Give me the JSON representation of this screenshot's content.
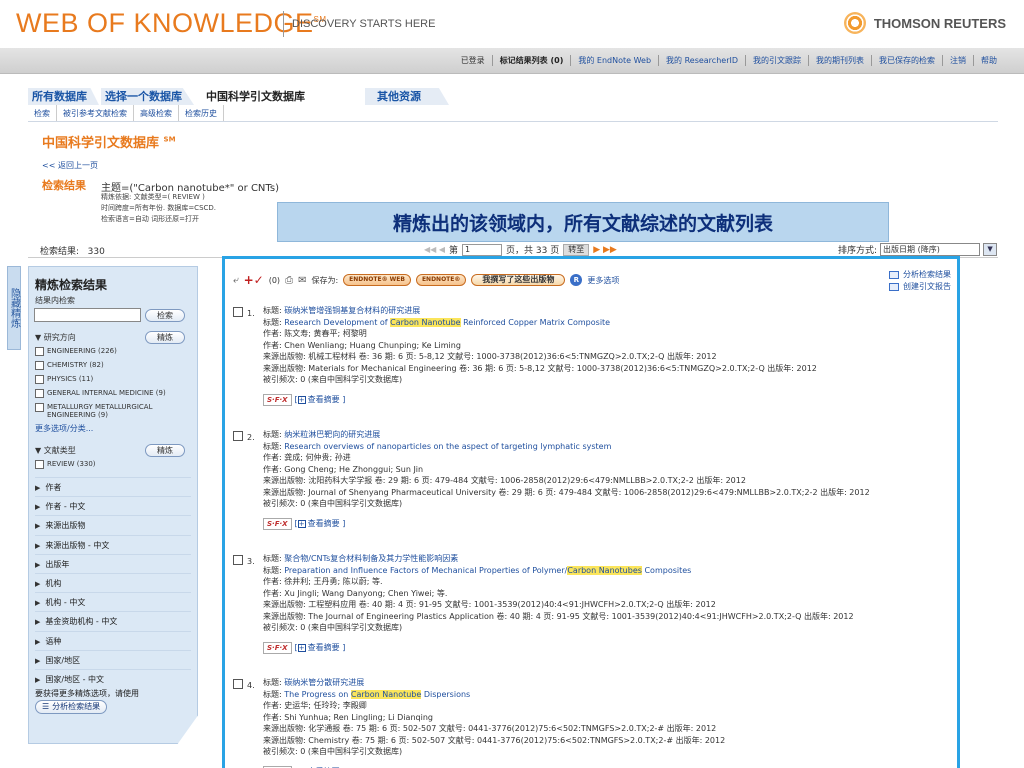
{
  "header": {
    "logo_text": "WEB OF KNOWLEDGE",
    "logo_mark": "SM",
    "tagline": "DISCOVERY STARTS HERE",
    "brand": "THOMSON REUTERS"
  },
  "toplinks": [
    {
      "label": "已登录",
      "style": "plain"
    },
    {
      "label": "标记结果列表 (0)",
      "style": "bold"
    },
    {
      "label": "我的 EndNote Web",
      "style": "link"
    },
    {
      "label": "我的 ResearcherID",
      "style": "link"
    },
    {
      "label": "我的引文跟踪",
      "style": "link"
    },
    {
      "label": "我的期刊列表",
      "style": "link"
    },
    {
      "label": "我已保存的检索",
      "style": "link"
    },
    {
      "label": "注销",
      "style": "link"
    },
    {
      "label": "帮助",
      "style": "link"
    }
  ],
  "tabs": {
    "all_databases": "所有数据库",
    "select_database": "选择一个数据库",
    "current": "中国科学引文数据库",
    "other_resources": "其他资源"
  },
  "subtabs": [
    "检索",
    "被引参考文献检索",
    "高级检索",
    "检索历史"
  ],
  "page": {
    "title": "中国科学引文数据库",
    "title_mark": "SM",
    "back_link": "<< 返回上一页",
    "result_label": "检索结果",
    "query_main": "主题=(\"Carbon nanotube*\" or CNTs)",
    "query_lines": [
      "精炼依据: 文献类型=( REVIEW )",
      "时间跨度=所有年份. 数据库=CSCD.",
      "检索语言=自动  词形还原=打开"
    ],
    "callout": "精炼出的该领域内，所有文献综述的文献列表"
  },
  "results_bar": {
    "count_label": "检索结果:",
    "count_value": "330",
    "page_prefix": "第",
    "page_value": "1",
    "page_suffix": "页，共 33 页",
    "go_label": "转至",
    "sort_label": "排序方式:",
    "sort_value": "出版日期 (降序)"
  },
  "sidebar": {
    "vertical_tab": "隐藏精炼",
    "title": "精炼检索结果",
    "within_label": "结果内检索",
    "search_button": "检索",
    "subject_label": "研究方向",
    "refine_button": "精炼",
    "subjects": [
      "ENGINEERING (226)",
      "CHEMISTRY (82)",
      "PHYSICS (11)",
      "GENERAL INTERNAL MEDICINE (9)",
      "METALLURGY METALLURGICAL ENGINEERING (9)"
    ],
    "more_options": "更多选项/分类...",
    "doctype_label": "文献类型",
    "doctype_refine": "精炼",
    "doctypes": [
      "REVIEW (330)"
    ],
    "facets": [
      "作者",
      "作者 - 中文",
      "来源出版物",
      "来源出版物 - 中文",
      "出版年",
      "机构",
      "机构 - 中文",
      "基金资助机构 - 中文",
      "语种",
      "国家/地区",
      "国家/地区 - 中文"
    ],
    "note": "要获得更多精炼选项，请使用",
    "analyze_button": "分析检索结果"
  },
  "toolbar": {
    "marked_count": "(0)",
    "save_to": "保存为:",
    "endnote_web": "ENDNOTE® WEB",
    "endnote": "ENDNOTE®",
    "wrote_these": "我撰写了这些出版物",
    "r_badge": "R",
    "more_options": "更多选项",
    "analyze": "分析检索结果",
    "citation_report": "创建引文报告"
  },
  "records": [
    {
      "num": "1.",
      "title_cn": "碳纳米管增强铜基复合材料的研究进展",
      "title_en_pre": "Research Development of ",
      "title_en_hl": "Carbon Nanotube",
      "title_en_post": " Reinforced Copper Matrix Composite",
      "authors_cn": "陈文寿; 黄春平; 柯黎明",
      "authors_en": "Chen Wenliang; Huang Chunping; Ke Liming",
      "source_cn": "机械工程材料  卷: 36  期: 6  页: 5-8,12  文献号: 1000-3738(2012)36:6<5:TNMGZQ>2.0.TX;2-Q  出版年: 2012",
      "source_en": "Materials for Mechanical Engineering  卷: 36  期: 6  页: 5-8,12  文献号: 1000-3738(2012)36:6<5:TNMGZQ>2.0.TX;2-Q  出版年: 2012",
      "cited": "被引频次: 0 (来自中国科学引文数据库)"
    },
    {
      "num": "2.",
      "title_cn": "纳米粒淋巴靶向的研究进展",
      "title_en_pre": "Research overviews of nanoparticles on the aspect of targeting lymphatic system",
      "title_en_hl": "",
      "title_en_post": "",
      "authors_cn": "龚成; 何仲贵; 孙进",
      "authors_en": "Gong Cheng; He Zhonggui; Sun Jin",
      "source_cn": "沈阳药科大学学报  卷: 29  期: 6  页: 479-484  文献号: 1006-2858(2012)29:6<479:NMLLBB>2.0.TX;2-2  出版年: 2012",
      "source_en": "Journal of Shenyang Pharmaceutical University  卷: 29  期: 6  页: 479-484  文献号: 1006-2858(2012)29:6<479:NMLLBB>2.0.TX;2-2  出版年: 2012",
      "cited": "被引频次: 0 (来自中国科学引文数据库)"
    },
    {
      "num": "3.",
      "title_cn": "聚合物/CNTs复合材料制备及其力学性能影响因素",
      "title_en_pre": "Preparation and Influence Factors of Mechanical Properties of Polymer/",
      "title_en_hl": "Carbon Nanotubes",
      "title_en_post": " Composites",
      "authors_cn": "徐井利; 王丹勇; 陈以蔚; 等.",
      "authors_en": "Xu Jingli; Wang Danyong; Chen Yiwei; 等.",
      "source_cn": "工程塑料应用  卷: 40  期: 4  页: 91-95  文献号: 1001-3539(2012)40:4<91:JHWCFH>2.0.TX;2-Q  出版年: 2012",
      "source_en": "The Journal of Engineering Plastics Application  卷: 40  期: 4  页: 91-95  文献号: 1001-3539(2012)40:4<91:JHWCFH>2.0.TX;2-Q  出版年: 2012",
      "cited": "被引频次: 0 (来自中国科学引文数据库)"
    },
    {
      "num": "4.",
      "title_cn": "碳纳米管分散研究进展",
      "title_en_pre": "The Progress on ",
      "title_en_hl": "Carbon Nanotube",
      "title_en_post": " Dispersions",
      "authors_cn": "史运华; 任玲玲; 李殿卿",
      "authors_en": "Shi Yunhua; Ren Lingling; Li Dianqing",
      "source_cn": "化学通报  卷: 75  期: 6  页: 502-507  文献号: 0441-3776(2012)75:6<502:TNMGFS>2.0.TX;2-#  出版年: 2012",
      "source_en": "Chemistry  卷: 75  期: 6  页: 502-507  文献号: 0441-3776(2012)75:6<502:TNMGFS>2.0.TX;2-#  出版年: 2012",
      "cited": "被引频次: 0 (来自中国科学引文数据库)"
    }
  ],
  "labels": {
    "title": "标题:",
    "author": "作者:",
    "source": "来源出版物:",
    "sfx": "S·F·X",
    "view_abstract": "查看摘要"
  },
  "colors": {
    "brand_orange": "#e87a1e",
    "link_blue": "#1f4f9e",
    "callout_bg": "#b9d6ee",
    "panel_border": "#29a3e5",
    "highlight": "#fbe55b"
  }
}
